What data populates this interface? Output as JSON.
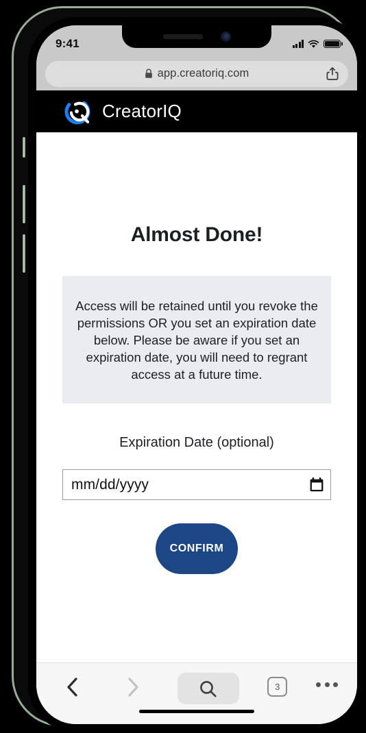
{
  "device": {
    "status_bar": {
      "time": "9:41",
      "cellular_icon": "signal-bars-icon",
      "wifi_icon": "wifi-icon",
      "battery_icon": "battery-icon"
    },
    "notch": {
      "speaker_icon": "speaker-grille-icon",
      "camera_icon": "front-camera-icon"
    }
  },
  "browser": {
    "url": "app.creatoriq.com",
    "lock_icon": "lock-icon",
    "share_icon": "share-icon",
    "toolbar": {
      "back_icon": "chevron-left-icon",
      "forward_icon": "chevron-right-icon",
      "search_icon": "search-icon",
      "tab_count": "3",
      "more_icon": "ellipsis-icon"
    }
  },
  "site": {
    "brand_name": "CreatorIQ",
    "logo_icon": "creatoriq-logo-icon",
    "header_bg": "#000000",
    "logo_accent": "#1f7df0"
  },
  "main": {
    "headline": "Almost Done!",
    "info_notice": "Access will be retained until you revoke the permissions OR you set an expiration date below. Please be aware if you set an expiration date, you will need to regrant access at a future time.",
    "info_bg": "#e9edf1",
    "form": {
      "label": "Expiration Date (optional)",
      "date_placeholder": "mm/dd/yyyy",
      "date_value": "",
      "calendar_icon": "calendar-icon",
      "submit_label": "CONFIRM",
      "submit_color": "#1d4685"
    }
  }
}
